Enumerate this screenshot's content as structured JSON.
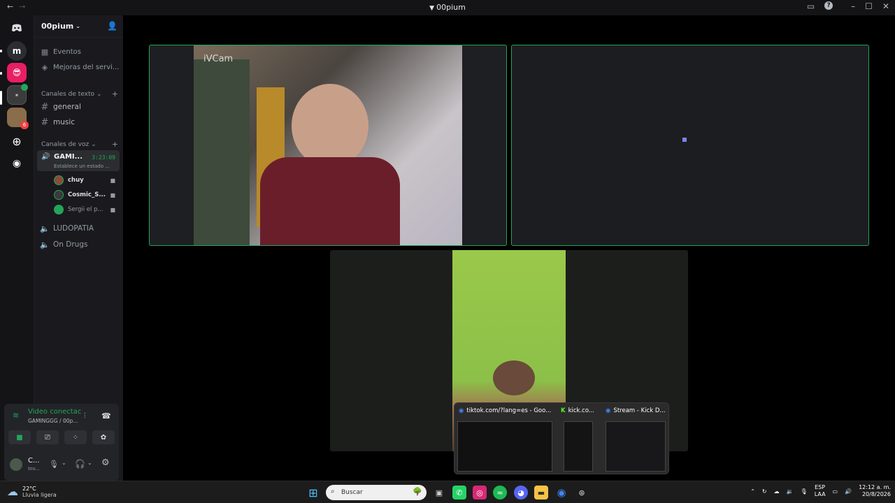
{
  "window": {
    "title": "00pium",
    "back_icon": "arrow-left-icon",
    "forward_icon": "arrow-right-icon"
  },
  "guilds": [
    {
      "name": "discord-home",
      "label": ""
    },
    {
      "name": "server-m",
      "label": "m"
    },
    {
      "name": "server-emoji",
      "label": ""
    },
    {
      "name": "server-2",
      "label": ""
    },
    {
      "name": "server-3",
      "label": "",
      "badge": "6"
    }
  ],
  "server": {
    "name": "00pium",
    "items": [
      {
        "label": "Eventos",
        "icon": "calendar-icon"
      },
      {
        "label": "Mejoras del servi...",
        "icon": "boost-icon"
      }
    ],
    "text_category": "Canales de texto",
    "text_channels": [
      "general",
      "music"
    ],
    "voice_category": "Canales de voz",
    "active_voice": {
      "name": "GAMI...",
      "time": "3:23:09",
      "status": "Establece un estado ..."
    },
    "members": [
      {
        "name": "chuy"
      },
      {
        "name": "Cosmic_S..."
      },
      {
        "name": "Sergii el p..."
      }
    ],
    "voice_channels": [
      "LUDOPATIA",
      "On Drugs"
    ]
  },
  "vc_panel": {
    "status": "Video conectac",
    "channel": "GAMINGGG / 00p...",
    "user_name": "C...",
    "user_status": "Inv..."
  },
  "tiles": {
    "watermark": "iVCam"
  },
  "taskbar": {
    "weather_temp": "22°C",
    "weather_desc": "Lluvia ligera",
    "search_placeholder": "Buscar",
    "lang": "ESP",
    "lang2": "LAA",
    "time": "12:12 a. m.",
    "date": "20/8/2026"
  },
  "previews": [
    {
      "title": "tiktok.com/?lang=es - Goo..."
    },
    {
      "title": "kick.co..."
    },
    {
      "title": "Stream - Kick D..."
    }
  ],
  "colors": {
    "accent_green": "#23a55a",
    "sidebar": "#1a1a1e",
    "guilds": "#141416"
  }
}
